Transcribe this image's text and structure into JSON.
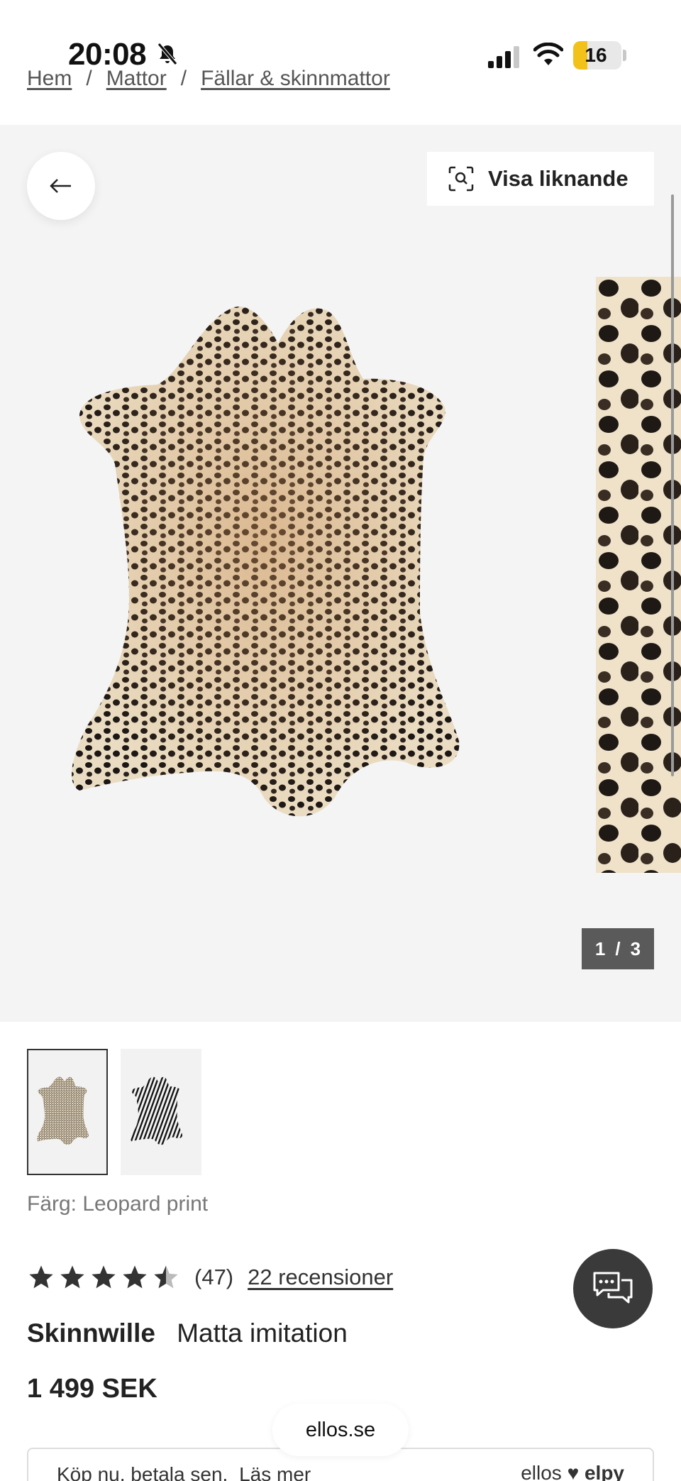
{
  "status_bar": {
    "time": "20:08",
    "battery": "16"
  },
  "breadcrumb": {
    "items": [
      "Hem",
      "Mattor",
      "Fällar & skinnmattor"
    ],
    "separator": "/"
  },
  "gallery": {
    "similar_button_label": "Visa liknande",
    "counter": {
      "current": "1",
      "sep": "/",
      "total": "3"
    }
  },
  "product": {
    "color_label": "Färg: Leopard print",
    "rating": {
      "stars": 4.5,
      "count": "(47)",
      "reviews_link": "22 recensioner"
    },
    "brand": "Skinnwille",
    "name": "Matta imitation",
    "price": "1 499 SEK"
  },
  "site_pill": "ellos.se",
  "pay_banner": {
    "text": "Köp nu, betala sen.",
    "link": "Läs mer",
    "logo_left": "ellos",
    "logo_right": "elpy"
  },
  "icons": {
    "back": "arrow-left-icon",
    "similar": "visual-search-icon",
    "chat": "chat-bubbles-icon",
    "bell_muted": "bell-slash-icon"
  }
}
